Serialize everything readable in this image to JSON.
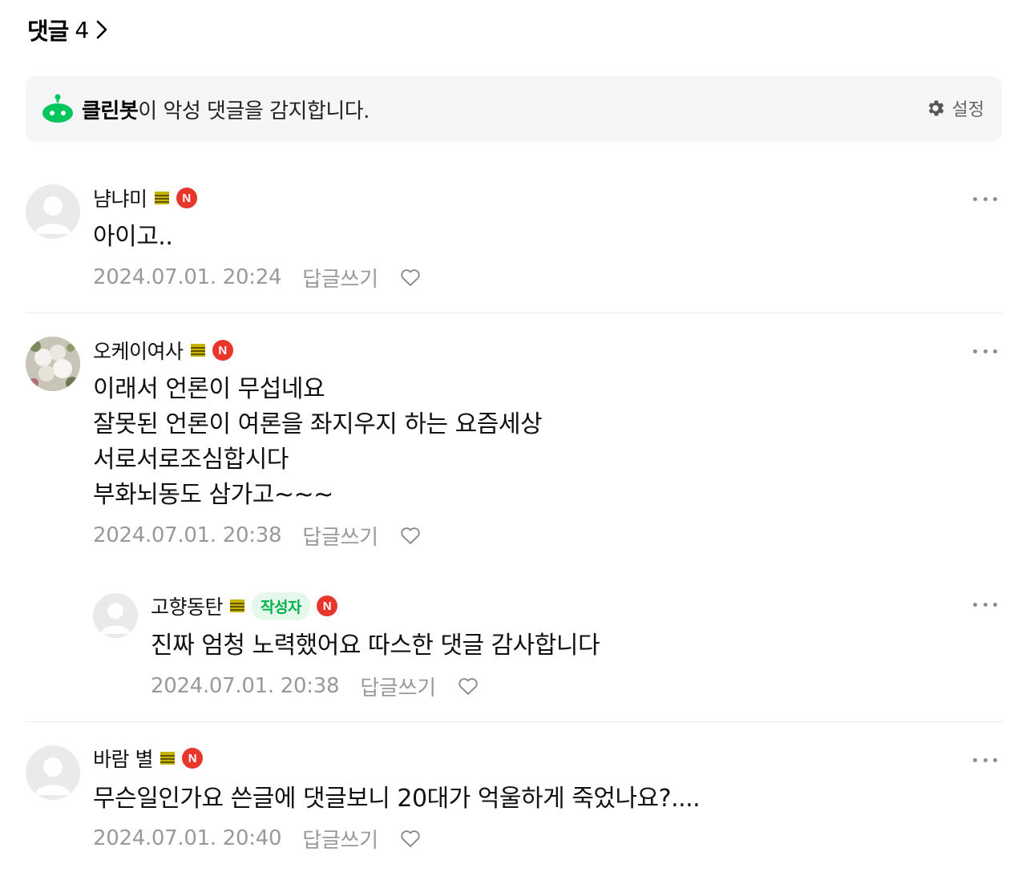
{
  "header": {
    "title": "댓글",
    "count": "4"
  },
  "banner": {
    "bot_name": "클린봇",
    "message": "이 악성 댓글을 감지합니다.",
    "settings_label": "설정"
  },
  "comments": [
    {
      "author": "냠냐미",
      "text": "아이고..",
      "date": "2024.07.01. 20:24",
      "reply_label": "답글쓰기"
    },
    {
      "author": "오케이여사",
      "lines": [
        "이래서 언론이 무섭네요",
        "잘못된 언론이 여론을 좌지우지 하는 요즘세상",
        "서로서로조심합시다",
        "부화뇌동도 삼가고~~~"
      ],
      "date": "2024.07.01. 20:38",
      "reply_label": "답글쓰기"
    },
    {
      "author": "고향동탄",
      "writer_badge": "작성자",
      "text": "진짜 엄청 노력했어요 따스한 댓글 감사합니다",
      "date": "2024.07.01. 20:38",
      "reply_label": "답글쓰기"
    },
    {
      "author": "바람 별",
      "text": "무슨일인가요 쓴글에 댓글보니 20대가 억울하게 죽었나요?....",
      "date": "2024.07.01. 20:40",
      "reply_label": "답글쓰기"
    }
  ],
  "colors": {
    "accent_green": "#03c75a",
    "naver_badge_red": "#e8362c",
    "meta_gray": "#999999"
  },
  "icons": {
    "cleanbot": "cleanbot-robot-icon",
    "settings": "gear-icon",
    "more": "more-dots-icon",
    "like": "heart-outline-icon",
    "grade": "member-grade-icon",
    "naver": "naver-n-badge-icon"
  }
}
